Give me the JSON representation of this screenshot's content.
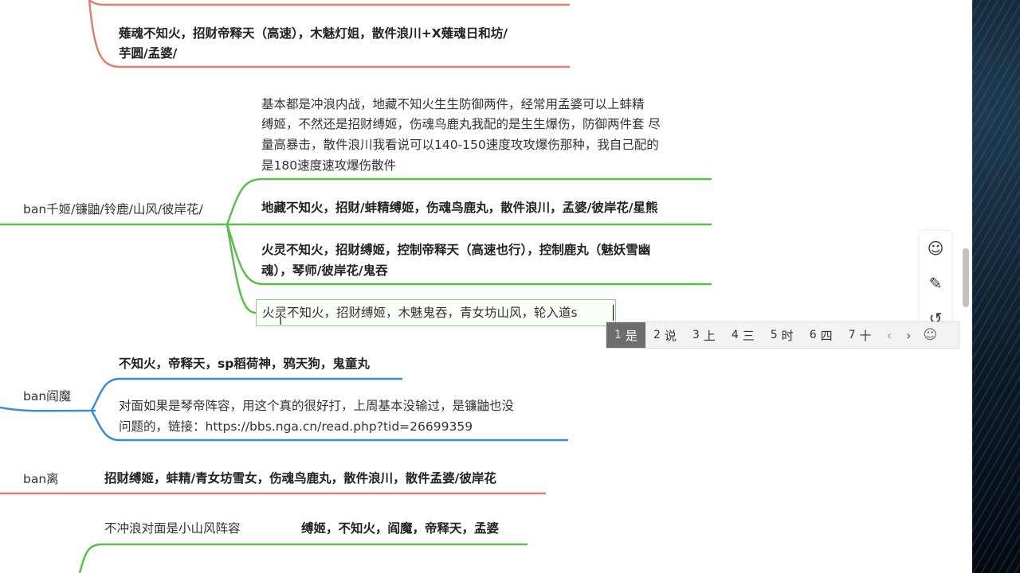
{
  "mindmap": {
    "nodes": {
      "top_combo": [
        "薙魂不知火，招财帝释天（高速），木魅灯姐，散件浪川+X薙魂日和坊/",
        "芋圆/孟婆/"
      ],
      "branch1_label": "ban千姬/镰鼬/铃鹿/山风/彼岸花/",
      "branch1_note": [
        "基本都是冲浪内战，地藏不知火生生防御两件，经常用孟婆可以上蚌精",
        "缚姬，不然还是招财缚姬，伤魂鸟鹿丸我配的是生生爆伤，防御两件套 尽",
        "量高暴击，散件浪川我看说可以140-150速度攻攻爆伤那种，我自己配的",
        "是180速度速攻爆伤散件"
      ],
      "branch1_combo1": "地藏不知火，招财/蚌精缚姬，伤魂鸟鹿丸，散件浪川，孟婆/彼岸花/星熊",
      "branch1_combo2": [
        "火灵不知火，招财缚姬，控制帝释天（高速也行），控制鹿丸（魅妖雪幽",
        "魂），琴师/彼岸花/鬼吞"
      ],
      "branch1_editing": "火灵不知火，招财缚姬，木魅鬼吞，青女坊山风，轮入道s",
      "branch2_label": "ban阎魔",
      "branch2_combo": "不知火，帝释天，sp稻荷神，鸦天狗，鬼童丸",
      "branch2_note": [
        "对面如果是琴帝阵容，用这个真的很好打，上周基本没输过，是镰鼬也没",
        "问题的，链接：https://bbs.nga.cn/read.php?tid=26699359"
      ],
      "branch3_label": "ban离",
      "branch3_combo": "招财缚姬，蚌精/青女坊雪女，伤魂鸟鹿丸，散件浪川，散件孟婆/彼岸花",
      "branch4_note": "不冲浪对面是小山风阵容",
      "branch4_combo": "缚姬，不知火，阎魔，帝释天，孟婆"
    },
    "colors": {
      "green": "#5bbd4e",
      "blue": "#3b8ad9",
      "red": "#e07f6d"
    }
  },
  "ime": {
    "candidates": [
      {
        "num": "1",
        "text": "是"
      },
      {
        "num": "2",
        "text": "说"
      },
      {
        "num": "3",
        "text": "上"
      },
      {
        "num": "4",
        "text": "三"
      },
      {
        "num": "5",
        "text": "时"
      },
      {
        "num": "6",
        "text": "四"
      },
      {
        "num": "7",
        "text": "十"
      }
    ],
    "prev_icon": "‹",
    "next_icon": "›",
    "emoji_icon": "☺"
  },
  "toolbar": {
    "emoji_icon": "☺",
    "edit_icon": "✎",
    "history_icon": "↺"
  }
}
